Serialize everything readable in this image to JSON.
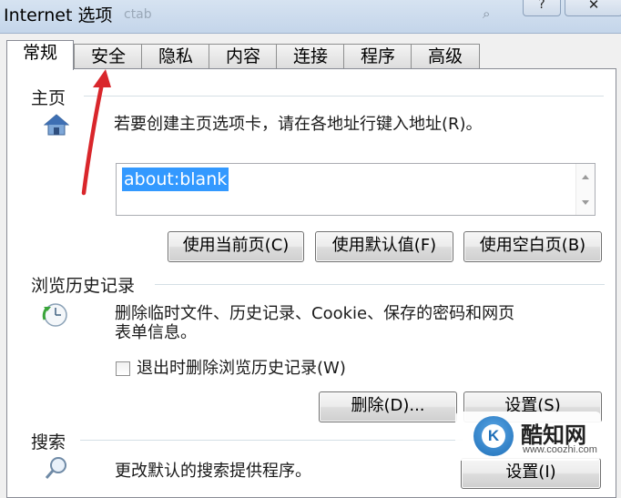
{
  "window": {
    "title": "Internet 选项",
    "bg_text": "ctab",
    "help_label": "?",
    "close_label": "✕"
  },
  "tabs": [
    {
      "label": "常规",
      "active": true
    },
    {
      "label": "安全"
    },
    {
      "label": "隐私"
    },
    {
      "label": "内容"
    },
    {
      "label": "连接"
    },
    {
      "label": "程序"
    },
    {
      "label": "高级"
    }
  ],
  "home": {
    "title": "主页",
    "description": "若要创建主页选项卡，请在各地址行键入地址(R)。",
    "address_value": "about:blank",
    "buttons": {
      "use_current": "使用当前页(C)",
      "use_default": "使用默认值(F)",
      "use_blank": "使用空白页(B)"
    }
  },
  "history": {
    "title": "浏览历史记录",
    "description_line1": "删除临时文件、历史记录、Cookie、保存的密码和网页",
    "description_line2": "表单信息。",
    "checkbox_label": "退出时删除浏览历史记录(W)",
    "checkbox_checked": false,
    "delete_button": "删除(D)...",
    "settings_button": "设置(S)"
  },
  "search": {
    "title": "搜索",
    "description": "更改默认的搜索提供程序。",
    "settings_button": "设置(I)"
  },
  "watermark": {
    "logo_letter": "K",
    "brand": "酷知网",
    "url": "www.coozhi.com"
  },
  "colors": {
    "selection": "#3399ff",
    "annotation_arrow": "#d9262b",
    "panel_bg": "#ffffff",
    "dialog_bg": "#f0f0f0"
  },
  "icons": [
    "house-icon",
    "history-clock-icon",
    "search-magnifier-icon",
    "annotation-arrow-icon"
  ]
}
